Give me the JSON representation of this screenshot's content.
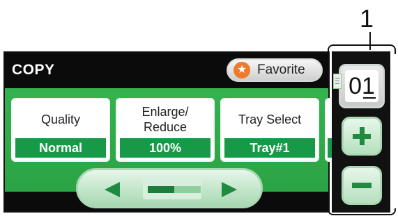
{
  "callout": {
    "number": "1"
  },
  "header": {
    "title": "COPY",
    "favorite_label": "Favorite",
    "favorite_icon": "star-icon"
  },
  "settings": [
    {
      "label": "Quality",
      "value": "Normal"
    },
    {
      "label": "Enlarge/\nReduce",
      "value": "100%"
    },
    {
      "label": "Tray Select",
      "value": "Tray#1"
    }
  ],
  "scrollbar": {
    "left_icon": "left-arrow-icon",
    "right_icon": "right-arrow-icon",
    "position_fraction": 0.5
  },
  "side_panel": {
    "copy_count": "01",
    "plus_icon": "plus-icon",
    "minus_icon": "minus-icon"
  },
  "colors": {
    "accent_green": "#2aa344",
    "value_green": "#169a48",
    "favorite_orange": "#ee7a2c"
  }
}
